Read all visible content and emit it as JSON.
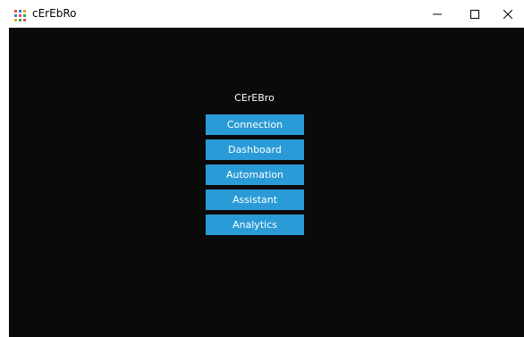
{
  "window": {
    "title": "cErEbRo"
  },
  "main": {
    "heading": "CErEBro",
    "buttons": [
      {
        "label": "Connection"
      },
      {
        "label": "Dashboard"
      },
      {
        "label": "Automation"
      },
      {
        "label": "Assistant"
      },
      {
        "label": "Analytics"
      }
    ]
  },
  "colors": {
    "background": "#0a0a0a",
    "button": "#2a9bd6",
    "text": "#ffffff"
  },
  "icons": {
    "app": "app-grid-icon",
    "minimize": "minimize-icon",
    "maximize": "maximize-icon",
    "close": "close-icon"
  }
}
